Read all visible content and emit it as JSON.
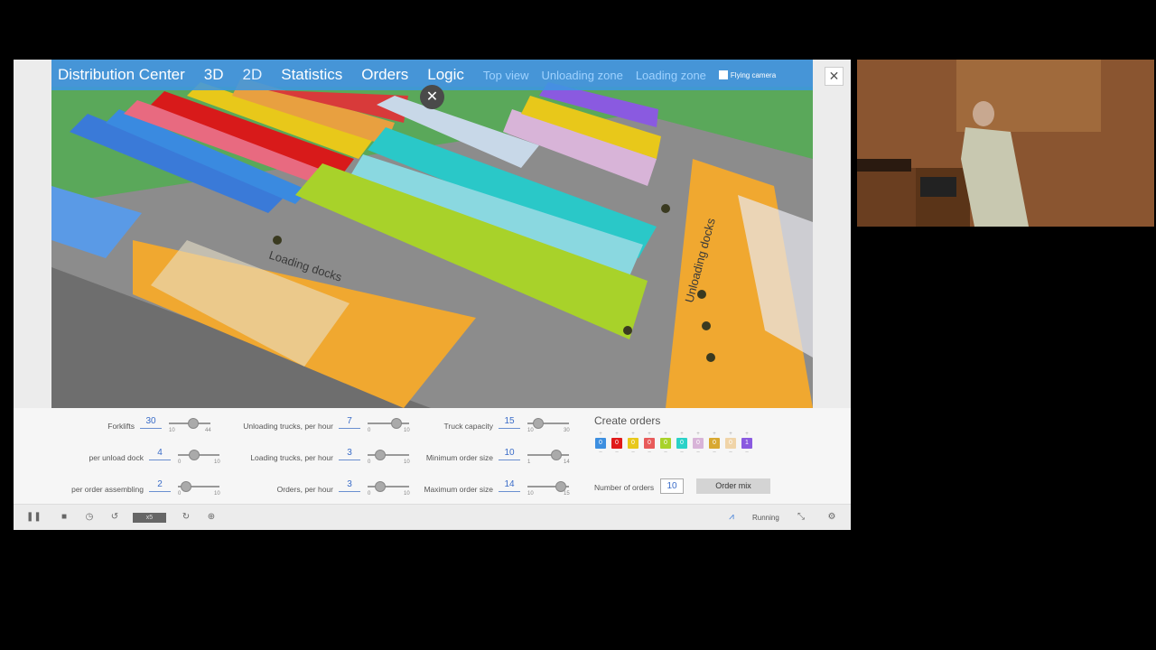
{
  "topbar": {
    "title": "Distribution Center",
    "tabs": [
      "3D",
      "2D",
      "Statistics",
      "Orders",
      "Logic"
    ],
    "camera_views": [
      "Top view",
      "Unloading zone",
      "Loading zone"
    ],
    "flying_camera": "Flying camera"
  },
  "scene_labels": {
    "loading_docks": "Loading docks",
    "unloading_docks": "Unloading docks"
  },
  "controls": {
    "forklifts": {
      "label": "Forklifts",
      "value": "30",
      "min": "10",
      "max": "44",
      "fraction": 0.59
    },
    "per_unload_dock": {
      "label": "per unload dock",
      "value": "4",
      "min": "0",
      "max": "10",
      "fraction": 0.4
    },
    "per_order_assembling": {
      "label": "per order assembling",
      "value": "2",
      "min": "0",
      "max": "10",
      "fraction": 0.2
    },
    "unloading_trucks": {
      "label": "Unloading trucks, per hour",
      "value": "7",
      "min": "0",
      "max": "10",
      "fraction": 0.7
    },
    "loading_trucks": {
      "label": "Loading trucks, per hour",
      "value": "3",
      "min": "0",
      "max": "10",
      "fraction": 0.3
    },
    "orders_per_hour": {
      "label": "Orders, per hour",
      "value": "3",
      "min": "0",
      "max": "10",
      "fraction": 0.3
    },
    "truck_capacity": {
      "label": "Truck capacity",
      "value": "15",
      "min": "10",
      "max": "30",
      "fraction": 0.25
    },
    "min_order_size": {
      "label": "Minimum order size",
      "value": "10",
      "min": "1",
      "max": "14",
      "fraction": 0.7
    },
    "max_order_size": {
      "label": "Maximum order size",
      "value": "14",
      "min": "10",
      "max": "15",
      "fraction": 0.8
    }
  },
  "create_orders": {
    "title": "Create orders",
    "swatches": [
      {
        "value": "0",
        "color": "#3d8fe0"
      },
      {
        "value": "0",
        "color": "#e01a1a"
      },
      {
        "value": "0",
        "color": "#e8c81a"
      },
      {
        "value": "0",
        "color": "#e85a5a"
      },
      {
        "value": "0",
        "color": "#a8d22a"
      },
      {
        "value": "0",
        "color": "#2ad2c8"
      },
      {
        "value": "0",
        "color": "#d8b4d8"
      },
      {
        "value": "0",
        "color": "#d8a830"
      },
      {
        "value": "0",
        "color": "#f0d4a8"
      },
      {
        "value": "1",
        "color": "#8a5ae0"
      }
    ],
    "number_of_orders_label": "Number of orders",
    "number_of_orders": "10",
    "order_mix": "Order mix"
  },
  "status": {
    "speed": "x5",
    "running": "Running"
  }
}
